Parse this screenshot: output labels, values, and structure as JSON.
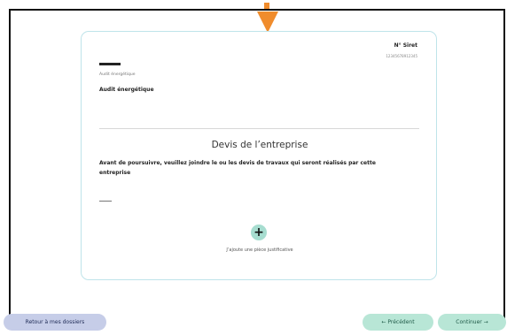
{
  "header": {
    "siret_label": "N° Siret",
    "siret_value": "12345678912345"
  },
  "item": {
    "small_label": "Audit énergétique",
    "title": "Audit énergétique"
  },
  "section": {
    "title": "Devis de l’entreprise",
    "description": "Avant de poursuivre, veuillez joindre le ou les devis de travaux qui seront réalisés par cette entreprise",
    "placeholder_dash": "——"
  },
  "upload": {
    "icon": "plus-icon",
    "label": "J’ajoute une pièce justificative"
  },
  "footer": {
    "back_label": "Retour à mes dossiers",
    "prev_label": "← Précédent",
    "next_label": "Continuer →"
  },
  "colors": {
    "accent_orange": "#f08c2c",
    "card_border": "#bfe4ea",
    "mint": "#b8e6d6",
    "lavender": "#c6cde8"
  }
}
